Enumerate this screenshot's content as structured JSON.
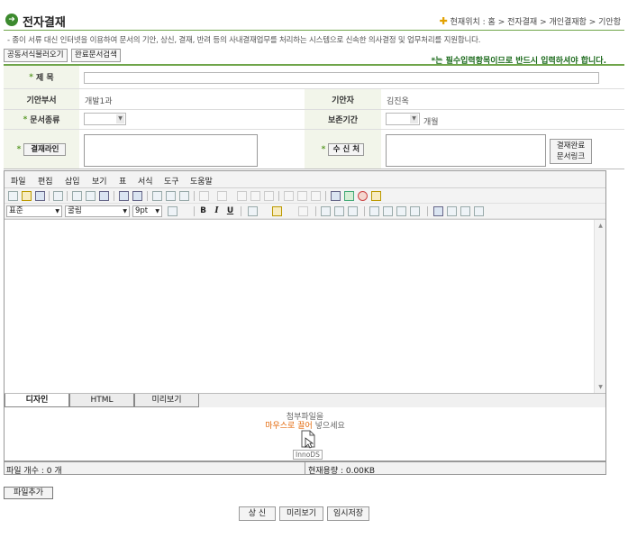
{
  "header": {
    "title": "전자결재",
    "location_label": "현재위치 :",
    "breadcrumb": [
      "홈",
      "전자결재",
      "개인결재함",
      "기안함"
    ]
  },
  "description": "- 종이 서류 대신 인터넷을 이용하여 문서의 기안, 상신, 결재, 반려 등의 사내결재업무를 처리하는 시스템으로 신속한 의사결정 및 업무처리를 지원합니다.",
  "top_buttons": {
    "common_form": "공동서식불러오기",
    "completed_search": "완료문서검색"
  },
  "required_notice": "*는 필수입력항목이므로 반드시 입력하셔야 합니다.",
  "form": {
    "subject_label": "제 목",
    "subject_value": "",
    "dept_label": "기안부서",
    "dept_value": "개발1과",
    "drafter_label": "기안자",
    "drafter_value": "김진옥",
    "doc_type_label": "문서종류",
    "doc_type_value": "",
    "retention_label": "보존기간",
    "retention_value": "",
    "retention_unit": "개월",
    "approval_line_button": "결재라인",
    "recipient_button": "수 신 처",
    "link_button_line1": "결재완료",
    "link_button_line2": "문서링크"
  },
  "editor": {
    "menus": [
      "파일",
      "편집",
      "삽입",
      "보기",
      "표",
      "서식",
      "도구",
      "도움말"
    ],
    "style_value": "표준",
    "font_value": "굴림",
    "size_value": "9pt",
    "bold": "B",
    "italic": "I",
    "underline": "U",
    "tabs": [
      "디자인",
      "HTML",
      "미리보기"
    ]
  },
  "attachment": {
    "line1": "첨부파일을",
    "drag_text": "마우스로 끌어",
    "line2_suffix": "넣으세요",
    "logo": "InnoDS",
    "file_count": "파일 개수 : 0 개",
    "current_size": "현재용량 : 0.00KB",
    "add_file_button": "파일추가"
  },
  "bottom_buttons": {
    "submit": "상 신",
    "preview": "미리보기",
    "temp_save": "임시저장"
  }
}
